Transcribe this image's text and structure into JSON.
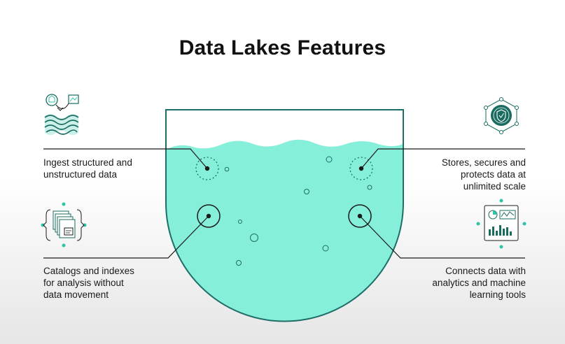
{
  "title": "Data Lakes Features",
  "features": [
    {
      "id": "ingest",
      "lines": [
        "Ingest structured and",
        "unstructured data"
      ]
    },
    {
      "id": "stores",
      "lines": [
        "Stores, secures and",
        "protects data at",
        "unlimited scale"
      ]
    },
    {
      "id": "catalogs",
      "lines": [
        "Catalogs and indexes",
        "for analysis without",
        "data movement"
      ]
    },
    {
      "id": "connects",
      "lines": [
        "Connects data with",
        "analytics and machine",
        "learning tools"
      ]
    }
  ],
  "icons": {
    "ingest": "ingest-data-icon",
    "stores": "security-network-icon",
    "catalogs": "catalog-documents-icon",
    "connects": "analytics-dashboard-icon"
  },
  "colors": {
    "water": "#86efd9",
    "water_dark": "#6fdcc6",
    "outline": "#1d6e68",
    "icon_accent": "#2ec4a6",
    "icon_dark": "#1a6b60",
    "text": "#1a1a1a"
  }
}
